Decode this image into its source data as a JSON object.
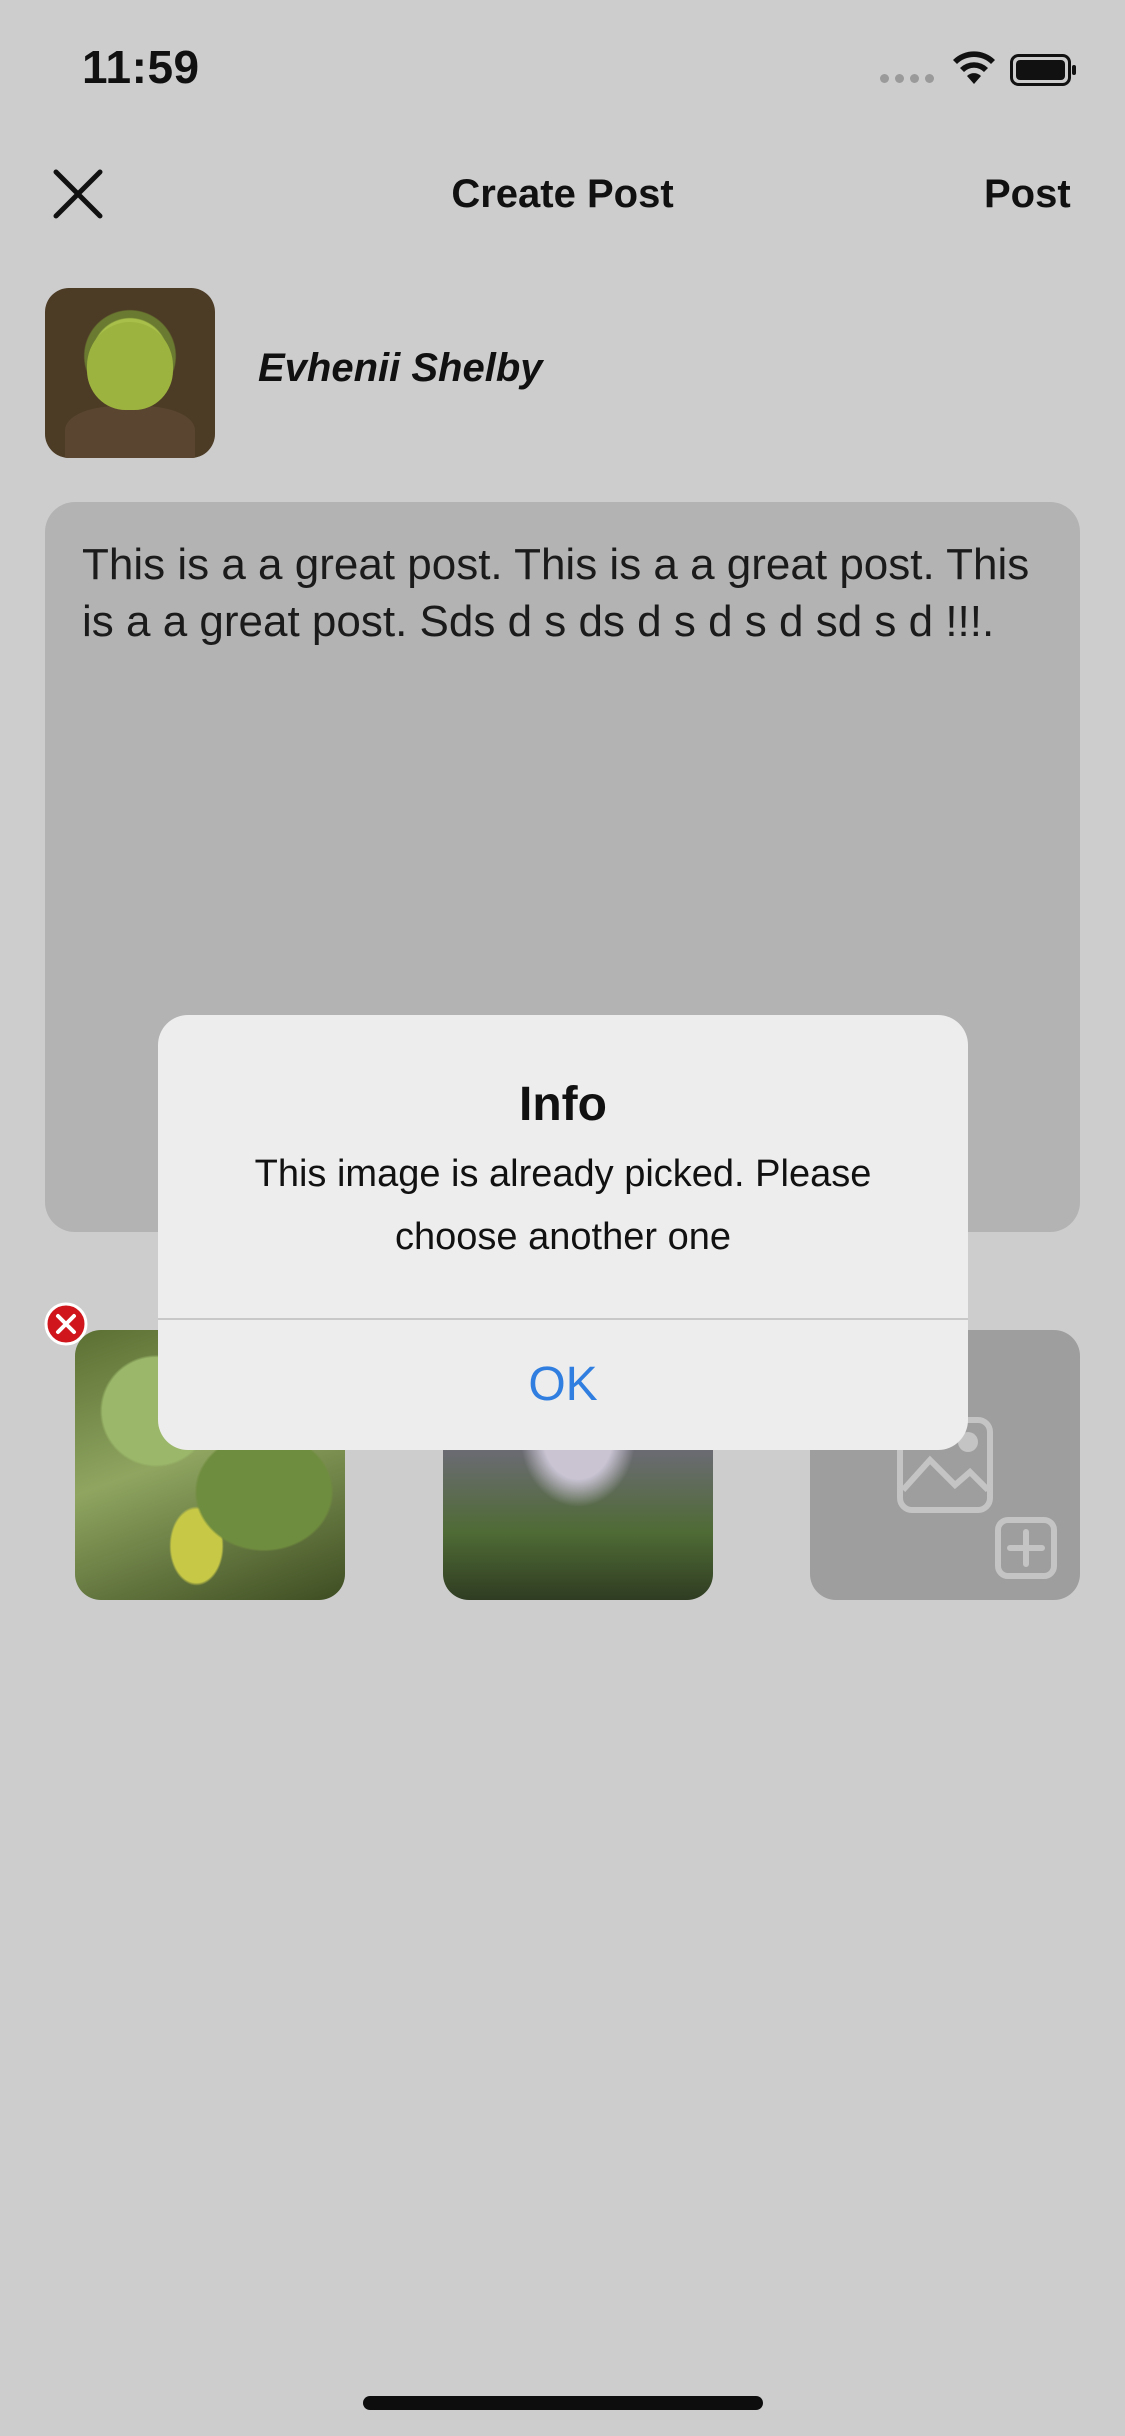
{
  "status_bar": {
    "time": "11:59"
  },
  "nav": {
    "title": "Create Post",
    "post_label": "Post"
  },
  "author": {
    "name": "Evhenii Shelby"
  },
  "post": {
    "text": "This is a a great post. This is a a great post. This is a a great post. Sds d s ds d s d s d sd s d !!!."
  },
  "alert": {
    "title": "Info",
    "message": "This image is already picked. Please choose another one",
    "ok_label": "OK"
  },
  "colors": {
    "accent": "#2f7ee0",
    "remove_badge": "#d0161c",
    "background": "#cdcdcd"
  },
  "icons": [
    "close-icon",
    "wifi-icon",
    "battery-icon",
    "add-image-icon",
    "remove-icon"
  ]
}
